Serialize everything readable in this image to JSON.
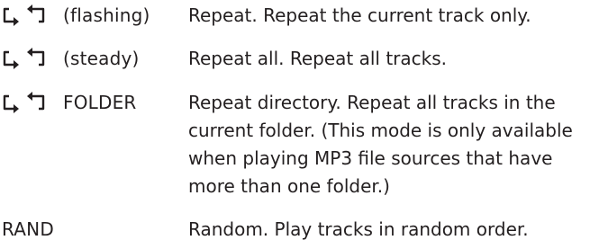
{
  "rows": [
    {
      "icon": "repeat-icon",
      "mode": "(flashing)",
      "description": "Repeat. Repeat the current track only."
    },
    {
      "icon": "repeat-icon",
      "mode": "(steady)",
      "description": "Repeat all. Repeat all tracks."
    },
    {
      "icon": "repeat-icon",
      "mode": "FOLDER",
      "description_lines": [
        "Repeat directory. Repeat all tracks in the",
        "current folder. (This mode is only available",
        "when playing MP3 file sources that have",
        "more than one folder.)"
      ]
    },
    {
      "mode": "RAND",
      "description": "Random. Play tracks in random order."
    }
  ],
  "colors": {
    "text": "#231f20",
    "background": "#ffffff"
  }
}
